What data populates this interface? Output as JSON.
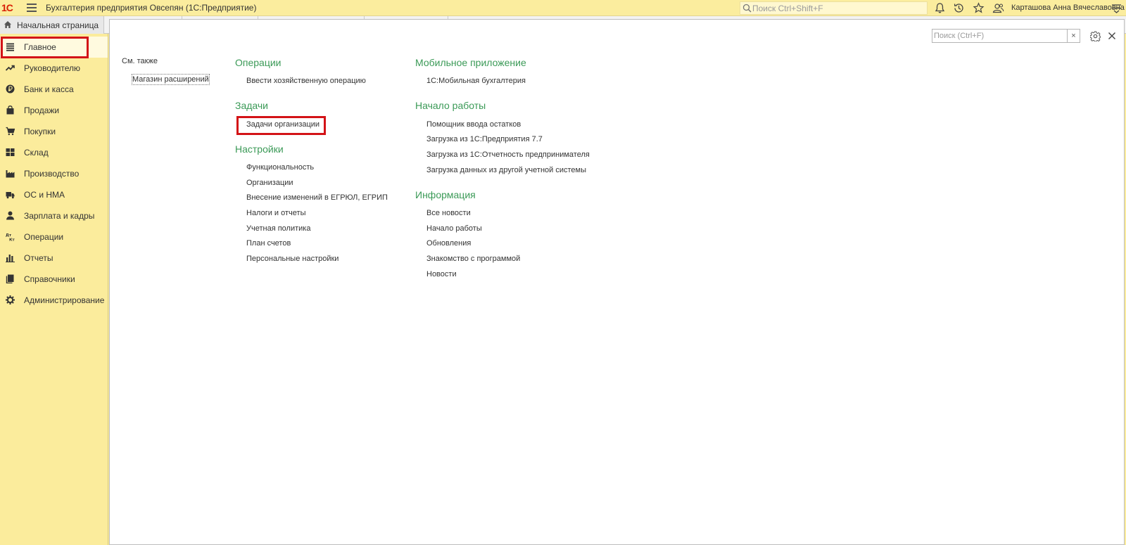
{
  "app": {
    "logo": "1С",
    "title": "Бухгалтерия предприятия Овсепян  (1С:Предприятие)",
    "search_placeholder": "Поиск Ctrl+Shift+F",
    "user": "Карташова Анна Вячеславовна"
  },
  "tabs": {
    "home": "Начальная страница"
  },
  "sidebar": {
    "items": [
      {
        "label": "Главное",
        "icon": "menu-icon"
      },
      {
        "label": "Руководителю",
        "icon": "trend-icon"
      },
      {
        "label": "Банк и касса",
        "icon": "ruble-icon"
      },
      {
        "label": "Продажи",
        "icon": "bag-icon"
      },
      {
        "label": "Покупки",
        "icon": "cart-icon"
      },
      {
        "label": "Склад",
        "icon": "grid-icon"
      },
      {
        "label": "Производство",
        "icon": "factory-icon"
      },
      {
        "label": "ОС и НМА",
        "icon": "truck-icon"
      },
      {
        "label": "Зарплата и кадры",
        "icon": "person-icon"
      },
      {
        "label": "Операции",
        "icon": "operations-icon"
      },
      {
        "label": "Отчеты",
        "icon": "chart-icon"
      },
      {
        "label": "Справочники",
        "icon": "book-icon"
      },
      {
        "label": "Администрирование",
        "icon": "gear-icon"
      }
    ]
  },
  "panel": {
    "search_placeholder": "Поиск (Ctrl+F)",
    "clear": "×",
    "see_also": "См. также",
    "extensions_shop": "Магазин расширений",
    "col1": {
      "operations_title": "Операции",
      "operations_links": [
        "Ввести хозяйственную операцию"
      ],
      "tasks_title": "Задачи",
      "tasks_links": [
        "Задачи организации"
      ],
      "settings_title": "Настройки",
      "settings_links": [
        "Функциональность",
        "Организации",
        "Внесение изменений в ЕГРЮЛ, ЕГРИП",
        "Налоги и отчеты",
        "Учетная политика",
        "План счетов",
        "Персональные настройки"
      ]
    },
    "col2": {
      "mobile_title": "Мобильное приложение",
      "mobile_links": [
        "1С:Мобильная бухгалтерия"
      ],
      "start_title": "Начало работы",
      "start_links": [
        "Помощник ввода остатков",
        "Загрузка из 1С:Предприятия 7.7",
        "Загрузка из 1С:Отчетность предпринимателя",
        "Загрузка данных из другой учетной системы"
      ],
      "info_title": "Информация",
      "info_links": [
        "Все новости",
        "Начало работы",
        "Обновления",
        "Знакомство с программой",
        "Новости"
      ]
    }
  }
}
